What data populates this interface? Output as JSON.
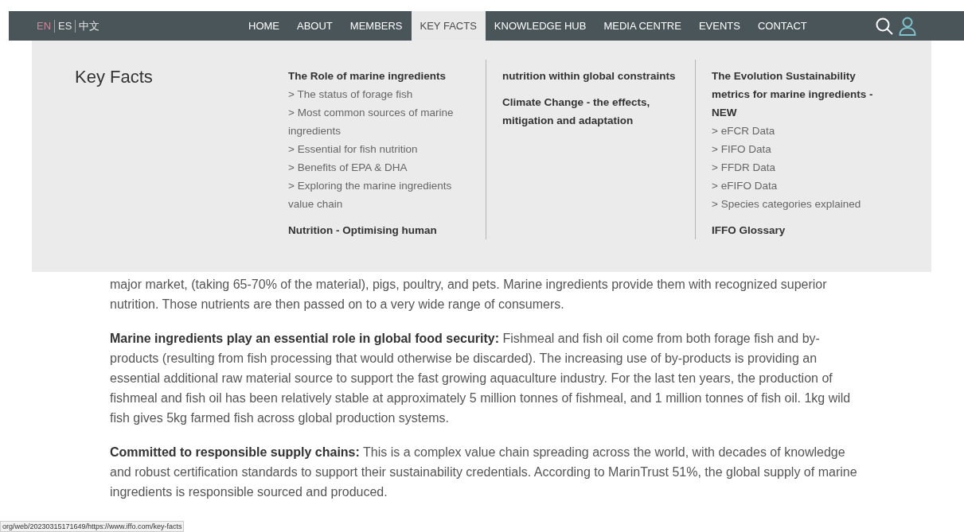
{
  "languages": [
    {
      "label": "EN",
      "selected": true
    },
    {
      "label": "ES",
      "selected": false
    },
    {
      "label": "中文",
      "selected": false
    }
  ],
  "nav": [
    {
      "label": "HOME",
      "selected": false
    },
    {
      "label": "ABOUT",
      "selected": false
    },
    {
      "label": "MEMBERS",
      "selected": false
    },
    {
      "label": "KEY FACTS",
      "selected": true
    },
    {
      "label": "KNOWLEDGE HUB",
      "selected": false
    },
    {
      "label": "MEDIA CENTRE",
      "selected": false
    },
    {
      "label": "EVENTS",
      "selected": false
    },
    {
      "label": "CONTACT",
      "selected": false
    }
  ],
  "dropdown": {
    "title": "Key Facts",
    "columns": [
      {
        "items": [
          {
            "kind": "heading",
            "text": "The Role of marine ingredients"
          },
          {
            "kind": "link",
            "text": "> The status of forage fish"
          },
          {
            "kind": "link",
            "text": "> Most common sources of marine ingredients"
          },
          {
            "kind": "link",
            "text": "> Essential for fish nutrition"
          },
          {
            "kind": "link",
            "text": "> Benefits of EPA & DHA"
          },
          {
            "kind": "link",
            "text": "> Exploring the marine ingredients value chain"
          },
          {
            "kind": "heading",
            "text": "Nutrition - Optimising human"
          }
        ]
      },
      {
        "items": [
          {
            "kind": "heading",
            "text": "nutrition within global constraints"
          },
          {
            "kind": "heading",
            "text": "Climate Change - the effects, mitigation and adaptation"
          }
        ]
      },
      {
        "items": [
          {
            "kind": "heading",
            "text": "The Evolution Sustainability metrics for marine ingredients - NEW"
          },
          {
            "kind": "link",
            "text": "> eFCR Data"
          },
          {
            "kind": "link",
            "text": "> FIFO Data"
          },
          {
            "kind": "link",
            "text": "> FFDR Data"
          },
          {
            "kind": "link",
            "text": "> eFIFO Data"
          },
          {
            "kind": "link",
            "text": "> Species categories explained"
          },
          {
            "kind": "heading",
            "text": "IFFO Glossary"
          }
        ]
      }
    ]
  },
  "paragraphs": [
    "major market, (taking 65-70% of the material), pigs, poultry, and pets. Marine ingredients provide them with recognized superior nutrition. Those nutrients are then passed on to a very wide range of consumers.",
    "**Marine ingredients play an essential role in global food security:** Fishmeal and fish oil come from both forage fish and by-products (resulting from fish processing that would otherwise be discarded). The increasing use of by-products is providing an essential additional raw material source to support the fast growing aquaculture industry. For the last ten years, the production of fishmeal and fish oil has been relatively stable at approximately 5 million tonnes of fishmeal, and 1 million tonnes of fish oil. 1kg wild fish gives 5kg farmed fish across global production systems.",
    "**Committed to responsible supply chains:** This is a complex value chain spreading across the world, with decades of knowledge and robust certification standards to support their sustainability credentials. According to MarinTrust 51%, the global supply of marine ingredients is responsible sourced and produced."
  ],
  "status_url": "org/web/20230315171649/https://www.iffo.com/key-facts"
}
